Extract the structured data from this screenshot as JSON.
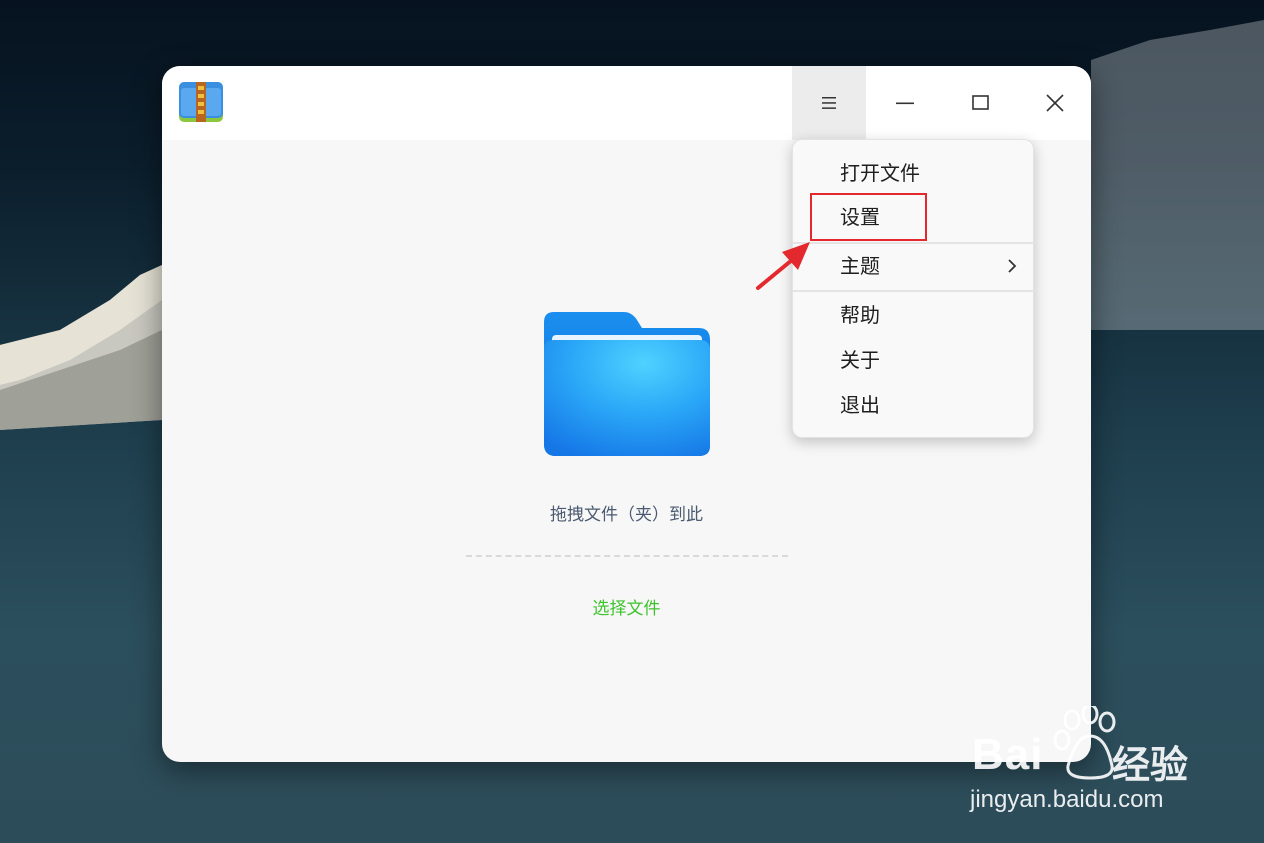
{
  "app": {
    "icon": "archive-manager-icon"
  },
  "titlebar": {
    "menu_icon": "hamburger-icon",
    "minimize_icon": "minimize-icon",
    "maximize_icon": "maximize-icon",
    "close_icon": "close-icon"
  },
  "main": {
    "folder_icon": "folder-icon",
    "drop_hint": "拖拽文件（夹）到此",
    "select_file": "选择文件"
  },
  "menu": {
    "items": [
      {
        "label": "打开文件"
      },
      {
        "label": "设置"
      },
      {
        "label": "主题",
        "has_submenu": true
      },
      {
        "label": "帮助"
      },
      {
        "label": "关于"
      },
      {
        "label": "退出"
      }
    ]
  },
  "annotation": {
    "highlighted_item": "设置",
    "color": "#e3282e"
  },
  "watermark": {
    "brand": "Bai",
    "brand_cn": "经验",
    "url": "jingyan.baidu.com"
  },
  "colors": {
    "accent_green": "#3dc42b",
    "folder_blue": "#1e9bf5",
    "annotation_red": "#e3282e"
  }
}
